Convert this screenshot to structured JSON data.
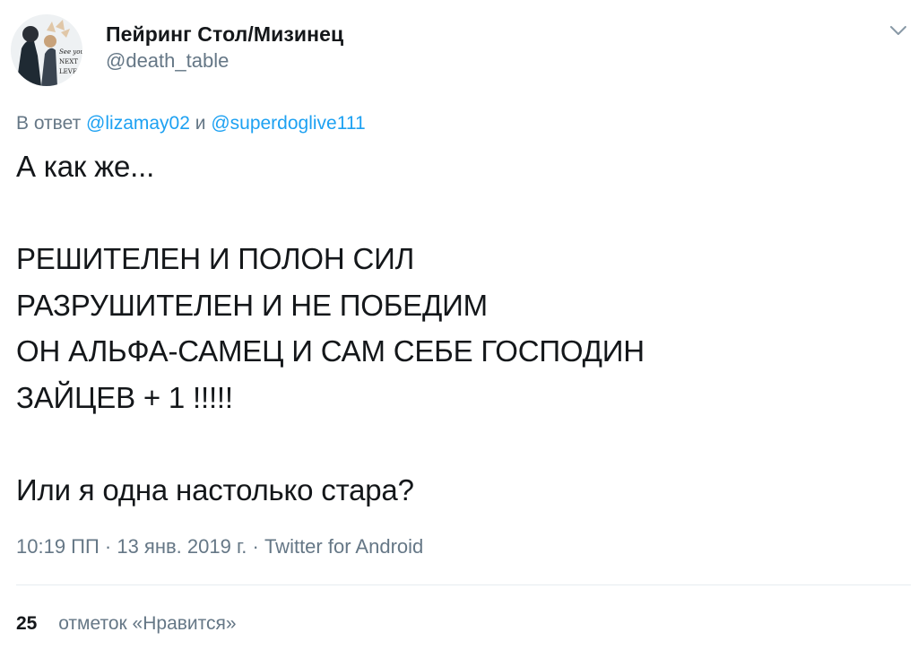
{
  "author": {
    "display_name": "Пейринг Стол/Мизинец",
    "handle": "@death_table",
    "avatar_icon": "avatar-image",
    "avatar_text": "See you NEXT LEVEL"
  },
  "menu": {
    "caret_icon": "chevron-down-icon"
  },
  "reply": {
    "prefix": "В ответ",
    "mention_1": "@lizamay02",
    "conjunction": "и",
    "mention_2": "@superdoglive111"
  },
  "tweet": {
    "text": "А как же...\n\nРЕШИТЕЛЕН И ПОЛОН СИЛ\nРАЗРУШИТЕЛЕН И НЕ ПОБЕДИМ\nОН АЛЬФА-САМЕЦ И САМ СЕБЕ ГОСПОДИН\nЗАЙЦЕВ + 1 !!!!!\n\nИли я одна настолько стара?"
  },
  "meta": {
    "text": "10:19 ПП · 13 янв. 2019 г. · Twitter for Android"
  },
  "likes": {
    "count": "25",
    "label": "отметок «Нравится»"
  },
  "colors": {
    "text": "#14171a",
    "secondary": "#657786",
    "link": "#1da1f2",
    "divider": "#e6ecf0"
  }
}
